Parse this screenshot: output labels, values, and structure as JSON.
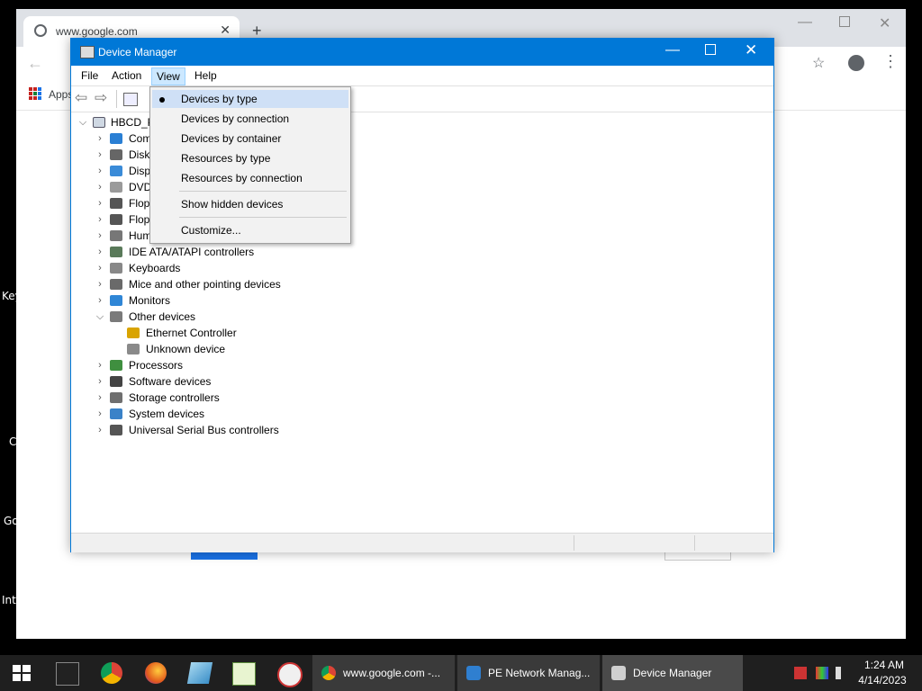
{
  "desktop": {
    "labels": [
      "Key",
      "C",
      "Go",
      "Inte"
    ]
  },
  "chrome": {
    "tab_title": "www.google.com",
    "tab_close": "✕",
    "new_tab": "+",
    "bookmarks_apps": "Apps"
  },
  "device_manager": {
    "title": "Device Manager",
    "menu": {
      "file": "File",
      "action": "Action",
      "view": "View",
      "help": "Help"
    },
    "tree": {
      "root": "HBCD_P",
      "categories": [
        {
          "label": "Com",
          "icon_color": "#2a7fd4"
        },
        {
          "label": "Disk",
          "icon_color": "#666666"
        },
        {
          "label": "Disp",
          "icon_color": "#3a8bd8"
        },
        {
          "label": "DVD",
          "icon_color": "#9a9a9a"
        },
        {
          "label": "Flop",
          "icon_color": "#555555"
        },
        {
          "label": "Flop",
          "icon_color": "#555555"
        },
        {
          "label": "Hum",
          "icon_color": "#777777"
        },
        {
          "label": "IDE ATA/ATAPI controllers",
          "icon_color": "#5a7a5a"
        },
        {
          "label": "Keyboards",
          "icon_color": "#888888"
        },
        {
          "label": "Mice and other pointing devices",
          "icon_color": "#6a6a6a"
        },
        {
          "label": "Monitors",
          "icon_color": "#2f86d6"
        },
        {
          "label": "Other devices",
          "icon_color": "#7a7a7a"
        },
        {
          "label": "Processors",
          "icon_color": "#3f8f3f"
        },
        {
          "label": "Software devices",
          "icon_color": "#444444"
        },
        {
          "label": "Storage controllers",
          "icon_color": "#6f6f6f"
        },
        {
          "label": "System devices",
          "icon_color": "#3a82c8"
        },
        {
          "label": "Universal Serial Bus controllers",
          "icon_color": "#555555"
        }
      ],
      "other_children": [
        {
          "label": "Ethernet Controller",
          "icon_color": "#d9a400"
        },
        {
          "label": "Unknown device",
          "icon_color": "#8a8a8a"
        }
      ]
    },
    "view_menu": {
      "items": [
        "Devices by type",
        "Devices by connection",
        "Devices by container",
        "Resources by type",
        "Resources by connection",
        "Show hidden devices",
        "Customize..."
      ],
      "selected": "Devices by type"
    }
  },
  "taskbar": {
    "tasks": [
      {
        "label": "www.google.com -...",
        "icon_color": "#e8b400"
      },
      {
        "label": "PE Network Manag...",
        "icon_color": "#2f7fd0"
      },
      {
        "label": "Device Manager",
        "icon_color": "#cfcfcf"
      }
    ],
    "time": "1:24 AM",
    "date": "4/14/2023"
  },
  "colors": {
    "dm_title_bar": "#0078d7",
    "menu_highlight": "#cfe0f6",
    "taskbar": "#1f1f1f",
    "active_task": "#3a3a3a"
  }
}
